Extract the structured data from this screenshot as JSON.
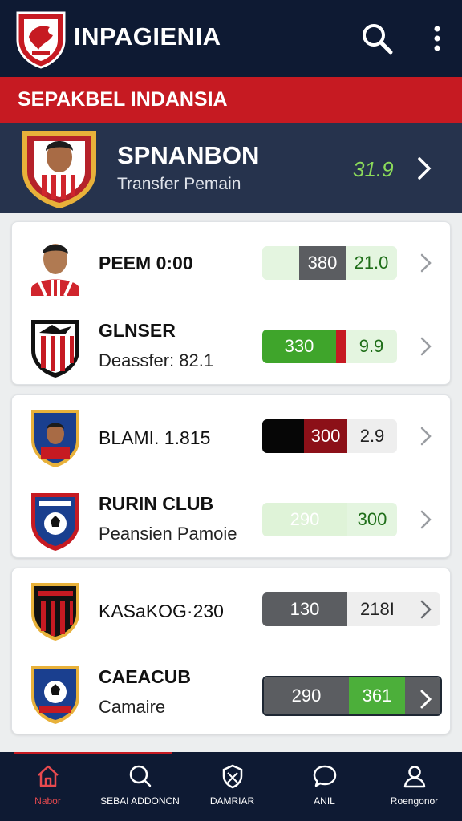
{
  "app": {
    "title": "INPAGIENIA"
  },
  "banner": {
    "label": "SEPAKBEL INDANSIA"
  },
  "feature": {
    "title": "SPNANBON",
    "subtitle": "Transfer Pemain",
    "value": "31.9"
  },
  "cards": [
    {
      "rows": [
        {
          "title": "PEEM 0:00",
          "left": "380",
          "right": "21.0"
        },
        {
          "title": "GLNSER",
          "subtitle": "Deassfer: 82.1",
          "left": "330",
          "right": "9.9"
        }
      ]
    },
    {
      "rows": [
        {
          "title": "BLAMI. 1.815",
          "left": "300",
          "right": "2.9"
        },
        {
          "title": "RURIN CLUB",
          "subtitle": "Peansien Pamoie",
          "left": "290",
          "right": "300"
        }
      ]
    },
    {
      "rows": [
        {
          "title": "KASaKOG·230",
          "left": "130",
          "right": "218I"
        },
        {
          "title": "CAEACUB",
          "subtitle": "Camaire",
          "left": "290",
          "right": "361"
        }
      ]
    }
  ],
  "nav": [
    {
      "label": "Nabor",
      "icon": "home-icon"
    },
    {
      "label": "SEBAI ADDONCN",
      "icon": "search-icon"
    },
    {
      "label": "DAMRIAR",
      "icon": "shield-icon"
    },
    {
      "label": "ANIL",
      "icon": "chat-icon"
    },
    {
      "label": "Roengonor",
      "icon": "user-icon"
    }
  ],
  "colors": {
    "navy": "#0e1a33",
    "red": "#c61a22",
    "green": "#3fa52b",
    "light_green": "#e4f5e0"
  }
}
